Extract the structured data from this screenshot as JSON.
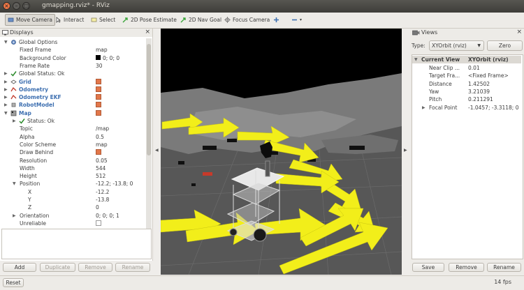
{
  "window": {
    "title": "gmapping.rviz* - RViz"
  },
  "toolbar": {
    "move_camera": "Move Camera",
    "interact": "Interact",
    "select": "Select",
    "pose_estimate": "2D Pose Estimate",
    "nav_goal": "2D Nav Goal",
    "focus_camera": "Focus Camera"
  },
  "displays": {
    "title": "Displays",
    "rows": [
      {
        "indent": 0,
        "expand": "▼",
        "icon": "gear",
        "label": "Global Options",
        "value": ""
      },
      {
        "indent": 1,
        "expand": "",
        "icon": "",
        "label": "Fixed Frame",
        "value": "map"
      },
      {
        "indent": 1,
        "expand": "",
        "icon": "",
        "label": "Background Color",
        "value": "0; 0; 0",
        "swatch": "#000000"
      },
      {
        "indent": 1,
        "expand": "",
        "icon": "",
        "label": "Frame Rate",
        "value": "30"
      },
      {
        "indent": 0,
        "expand": "▶",
        "icon": "check",
        "label": "Global Status: Ok",
        "value": ""
      },
      {
        "indent": 0,
        "expand": "▶",
        "icon": "grid",
        "label": "Grid",
        "value": "",
        "blue": true,
        "checkbox": true
      },
      {
        "indent": 0,
        "expand": "▶",
        "icon": "odom",
        "label": "Odometry",
        "value": "",
        "blue": true,
        "checkbox": true
      },
      {
        "indent": 0,
        "expand": "▶",
        "icon": "odom",
        "label": "Odometry EKF",
        "value": "",
        "blue": true,
        "checkbox": true
      },
      {
        "indent": 0,
        "expand": "▶",
        "icon": "robot",
        "label": "RobotModel",
        "value": "",
        "blue": true,
        "checkbox": true
      },
      {
        "indent": 0,
        "expand": "▼",
        "icon": "map",
        "label": "Map",
        "value": "",
        "blue": true,
        "checkbox": true
      },
      {
        "indent": 1,
        "expand": "▶",
        "icon": "check",
        "label": "Status: Ok",
        "value": ""
      },
      {
        "indent": 1,
        "expand": "",
        "icon": "",
        "label": "Topic",
        "value": "/map"
      },
      {
        "indent": 1,
        "expand": "",
        "icon": "",
        "label": "Alpha",
        "value": "0.5"
      },
      {
        "indent": 1,
        "expand": "",
        "icon": "",
        "label": "Color Scheme",
        "value": "map"
      },
      {
        "indent": 1,
        "expand": "",
        "icon": "",
        "label": "Draw Behind",
        "value": "",
        "checkbox": true
      },
      {
        "indent": 1,
        "expand": "",
        "icon": "",
        "label": "Resolution",
        "value": "0.05"
      },
      {
        "indent": 1,
        "expand": "",
        "icon": "",
        "label": "Width",
        "value": "544"
      },
      {
        "indent": 1,
        "expand": "",
        "icon": "",
        "label": "Height",
        "value": "512"
      },
      {
        "indent": 1,
        "expand": "▼",
        "icon": "",
        "label": "Position",
        "value": "-12.2; -13.8; 0"
      },
      {
        "indent": 2,
        "expand": "",
        "icon": "",
        "label": "X",
        "value": "-12.2"
      },
      {
        "indent": 2,
        "expand": "",
        "icon": "",
        "label": "Y",
        "value": "-13.8"
      },
      {
        "indent": 2,
        "expand": "",
        "icon": "",
        "label": "Z",
        "value": "0"
      },
      {
        "indent": 1,
        "expand": "▶",
        "icon": "",
        "label": "Orientation",
        "value": "0; 0; 0; 1"
      },
      {
        "indent": 1,
        "expand": "",
        "icon": "",
        "label": "Unreliable",
        "value": "",
        "checkbox": "empty"
      }
    ],
    "buttons": {
      "add": "Add",
      "duplicate": "Duplicate",
      "remove": "Remove",
      "rename": "Rename"
    }
  },
  "views": {
    "title": "Views",
    "type_label": "Type:",
    "type_value": "XYOrbit (rviz)",
    "zero": "Zero",
    "header_label": "Current View",
    "header_value": "XYOrbit (rviz)",
    "rows": [
      {
        "label": "Near Clip ...",
        "value": "0.01",
        "expand": ""
      },
      {
        "label": "Target Fra...",
        "value": "<Fixed Frame>",
        "expand": ""
      },
      {
        "label": "Distance",
        "value": "1.42502",
        "expand": ""
      },
      {
        "label": "Yaw",
        "value": "3.21039",
        "expand": ""
      },
      {
        "label": "Pitch",
        "value": "0.211291",
        "expand": ""
      },
      {
        "label": "Focal Point",
        "value": "-1.0457; -3.3118; 0",
        "expand": "▶"
      }
    ],
    "buttons": {
      "save": "Save",
      "remove": "Remove",
      "rename": "Rename"
    }
  },
  "status": {
    "reset": "Reset",
    "fps": "14 fps"
  },
  "colors": {
    "accent": "#e2774a",
    "arrow": "#f2ee1a",
    "map_gray": "#7a7a7a",
    "floor": "#555555"
  }
}
